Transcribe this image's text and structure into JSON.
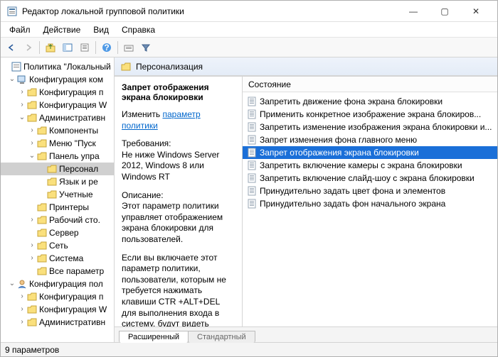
{
  "window": {
    "title": "Редактор локальной групповой политики",
    "minimize": "—",
    "maximize": "▢",
    "close": "✕"
  },
  "menu": {
    "file": "Файл",
    "action": "Действие",
    "view": "Вид",
    "help": "Справка"
  },
  "tree": {
    "root": "Политика \"Локальный",
    "computer": "Конфигурация ком",
    "comp_software": "Конфигурация п",
    "comp_windows": "Конфигурация W",
    "comp_admin": "Административн",
    "comp_components": "Компоненты",
    "comp_startmenu": "Меню \"Пуск",
    "comp_controlpanel": "Панель упра",
    "personalization": "Персонал",
    "regional": "Язык и ре",
    "accounts": "Учетные",
    "printers": "Принтеры",
    "desktop": "Рабочий сто.",
    "server": "Сервер",
    "network": "Сеть",
    "system": "Система",
    "all_params": "Все параметр",
    "user": "Конфигурация пол",
    "user_software": "Конфигурация п",
    "user_windows": "Конфигурация W",
    "user_admin": "Административн"
  },
  "header": {
    "title": "Персонализация"
  },
  "detail": {
    "title": "Запрет отображения экрана блокировки",
    "edit": "Изменить",
    "edit_link": "параметр политики",
    "req_label": "Требования:",
    "req_text": "Не ниже Windows Server 2012, Windows 8 или Windows RT",
    "desc_label": "Описание:",
    "desc_text": "Этот параметр политики управляет отображением экрана блокировки для пользователей.",
    "desc_text2": "Если вы включаете этот параметр политики, пользователи, которым не требуется нажимать клавиши CTR +ALT+DEL для выполнения входа в систему, будут видеть выбранную ими плитку после блокировки своего компьютера."
  },
  "list": {
    "col_state": "Состояние",
    "items": [
      "Запретить движение фона экрана блокировки",
      "Применить конкретное изображение экрана блокиров...",
      "Запретить изменение изображения экрана блокировки и...",
      "Запрет изменения фона главного меню",
      "Запрет отображения экрана блокировки",
      "Запретить включение камеры с экрана блокировки",
      "Запретить включение слайд-шоу с экрана блокировки",
      "Принудительно задать цвет фона и элементов",
      "Принудительно задать фон начального экрана"
    ],
    "selected_index": 4
  },
  "tabs": {
    "extended": "Расширенный",
    "standard": "Стандартный"
  },
  "status": {
    "text": "9 параметров"
  }
}
